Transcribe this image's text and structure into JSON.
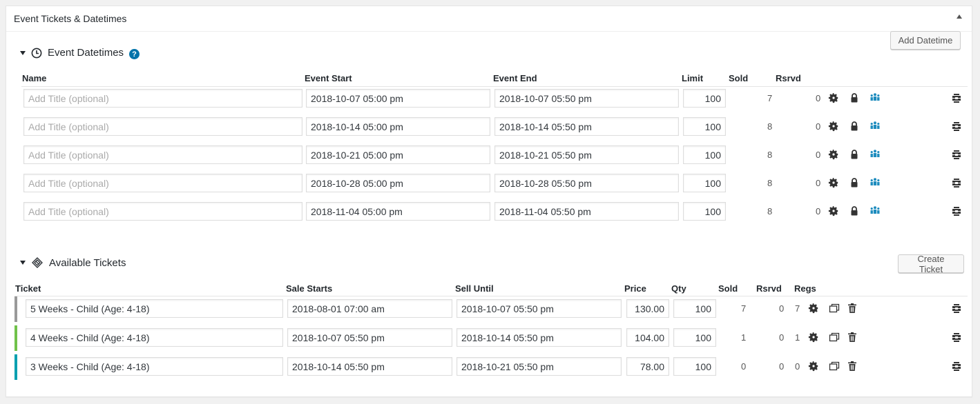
{
  "metabox": {
    "title": "Event Tickets & Datetimes"
  },
  "datetimes": {
    "section_title": "Event Datetimes",
    "help_glyph": "?",
    "add_button": "Add Datetime",
    "columns": {
      "name": "Name",
      "start": "Event Start",
      "end": "Event End",
      "limit": "Limit",
      "sold": "Sold",
      "rsrvd": "Rsrvd"
    },
    "placeholder": "Add Title (optional)",
    "rows": [
      {
        "start": "2018-10-07 05:00 pm",
        "end": "2018-10-07 05:50 pm",
        "limit": "100",
        "sold": "7",
        "rsrvd": "0"
      },
      {
        "start": "2018-10-14 05:00 pm",
        "end": "2018-10-14 05:50 pm",
        "limit": "100",
        "sold": "8",
        "rsrvd": "0"
      },
      {
        "start": "2018-10-21 05:00 pm",
        "end": "2018-10-21 05:50 pm",
        "limit": "100",
        "sold": "8",
        "rsrvd": "0"
      },
      {
        "start": "2018-10-28 05:00 pm",
        "end": "2018-10-28 05:50 pm",
        "limit": "100",
        "sold": "8",
        "rsrvd": "0"
      },
      {
        "start": "2018-11-04 05:00 pm",
        "end": "2018-11-04 05:50 pm",
        "limit": "100",
        "sold": "8",
        "rsrvd": "0"
      }
    ]
  },
  "tickets": {
    "section_title": "Available Tickets",
    "create_button": "Create Ticket",
    "columns": {
      "ticket": "Ticket",
      "sale_starts": "Sale Starts",
      "sell_until": "Sell Until",
      "price": "Price",
      "qty": "Qty",
      "sold": "Sold",
      "rsrvd": "Rsrvd",
      "regs": "Regs"
    },
    "rows": [
      {
        "name": "5 Weeks - Child (Age: 4-18)",
        "sale_starts": "2018-08-01 07:00 am",
        "sell_until": "2018-10-07 05:50 pm",
        "price": "130.00",
        "qty": "100",
        "sold": "7",
        "rsrvd": "0",
        "regs": "7",
        "status_color": "#999999"
      },
      {
        "name": "4 Weeks - Child (Age: 4-18)",
        "sale_starts": "2018-10-07 05:50 pm",
        "sell_until": "2018-10-14 05:50 pm",
        "price": "104.00",
        "qty": "100",
        "sold": "1",
        "rsrvd": "0",
        "regs": "1",
        "status_color": "#70c24a"
      },
      {
        "name": "3 Weeks - Child (Age: 4-18)",
        "sale_starts": "2018-10-14 05:50 pm",
        "sell_until": "2018-10-21 05:50 pm",
        "price": "78.00",
        "qty": "100",
        "sold": "0",
        "rsrvd": "0",
        "regs": "0",
        "status_color": "#00a0b0"
      }
    ]
  },
  "colors": {
    "accent": "#0073aa",
    "icon": "#333333"
  }
}
